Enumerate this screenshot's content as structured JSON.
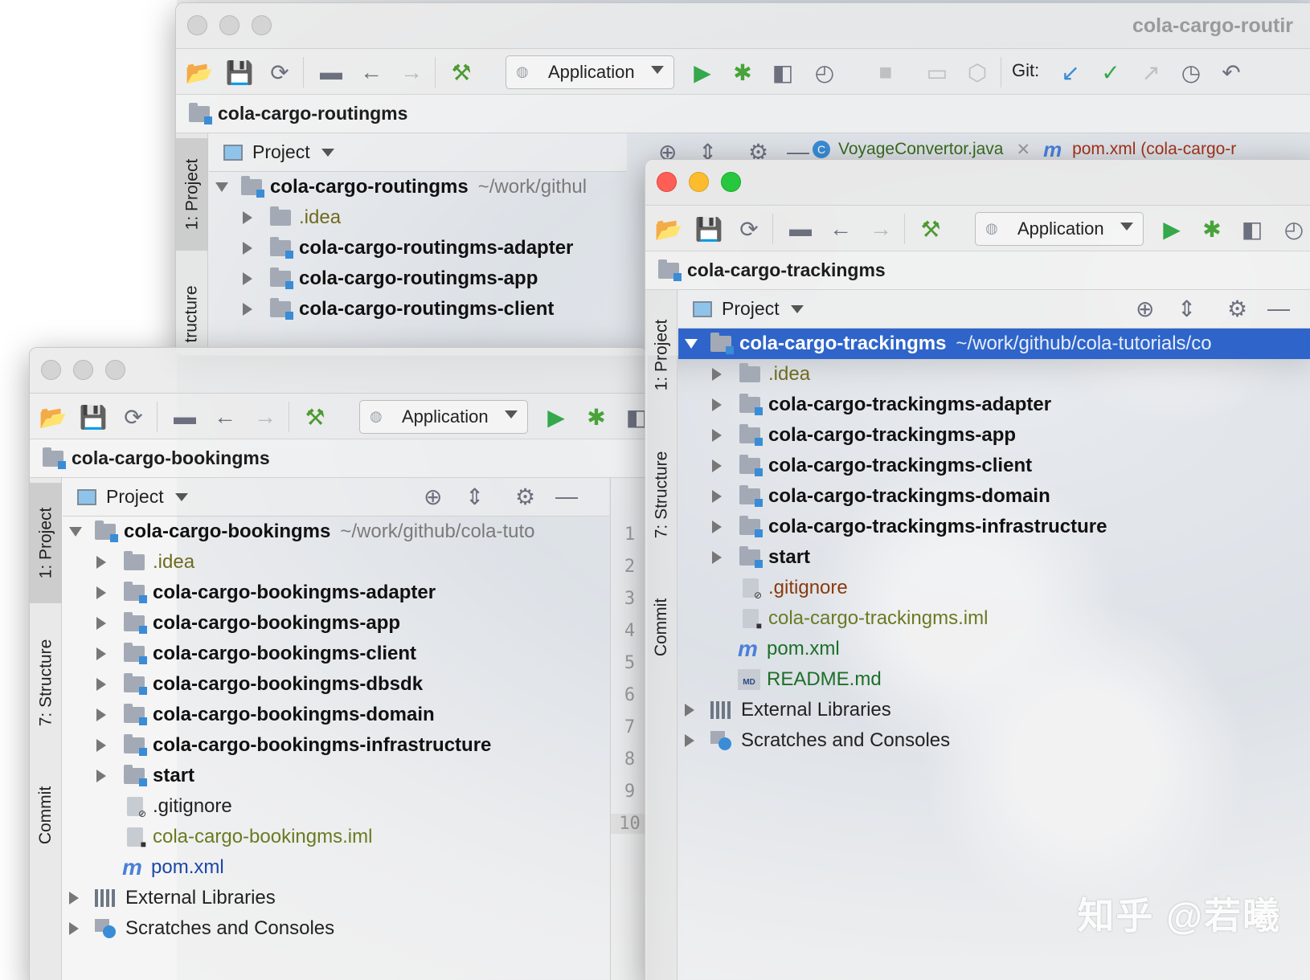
{
  "windows": {
    "routing": {
      "title": "cola-cargo-routir",
      "run_config": "Application",
      "git_label": "Git:",
      "breadcrumb": "cola-cargo-routingms",
      "panel_title": "Project",
      "side_tabs": [
        "1: Project",
        "tructure"
      ],
      "editor_tabs": [
        {
          "label": "VoyageConvertor.java",
          "icon": "C"
        },
        {
          "label": "pom.xml (cola-cargo-r",
          "icon": "m"
        }
      ],
      "tree": {
        "root_name": "cola-cargo-routingms",
        "root_path": "~/work/githul",
        "items": [
          ".idea",
          "cola-cargo-routingms-adapter",
          "cola-cargo-routingms-app",
          "cola-cargo-routingms-client"
        ]
      }
    },
    "booking": {
      "run_config": "Application",
      "breadcrumb": "cola-cargo-bookingms",
      "panel_title": "Project",
      "side_tabs": [
        "1: Project",
        "7: Structure",
        "Commit"
      ],
      "tree": {
        "root_name": "cola-cargo-bookingms",
        "root_path": "~/work/github/cola-tuto",
        "folders": [
          ".idea",
          "cola-cargo-bookingms-adapter",
          "cola-cargo-bookingms-app",
          "cola-cargo-bookingms-client",
          "cola-cargo-bookingms-dbsdk",
          "cola-cargo-bookingms-domain",
          "cola-cargo-bookingms-infrastructure",
          "start"
        ],
        "files": [
          ".gitignore",
          "cola-cargo-bookingms.iml",
          "pom.xml"
        ],
        "external": "External Libraries",
        "scratches": "Scratches and Consoles"
      },
      "gutter_lines": [
        "1",
        "2",
        "3",
        "4",
        "5",
        "6",
        "7",
        "8",
        "9",
        "10"
      ]
    },
    "tracking": {
      "run_config": "Application",
      "breadcrumb": "cola-cargo-trackingms",
      "panel_title": "Project",
      "side_tabs": [
        "1: Project",
        "7: Structure",
        "Commit"
      ],
      "tree": {
        "root_name": "cola-cargo-trackingms",
        "root_path": "~/work/github/cola-tutorials/co",
        "folders": [
          ".idea",
          "cola-cargo-trackingms-adapter",
          "cola-cargo-trackingms-app",
          "cola-cargo-trackingms-client",
          "cola-cargo-trackingms-domain",
          "cola-cargo-trackingms-infrastructure",
          "start"
        ],
        "files": [
          ".gitignore",
          "cola-cargo-trackingms.iml",
          "pom.xml",
          "README.md"
        ],
        "external": "External Libraries",
        "scratches": "Scratches and Consoles"
      }
    }
  },
  "watermark": "知乎 @若曦",
  "colors": {
    "selection": "#2f65ca",
    "run_green": "#34a84a",
    "git_blue": "#3a8cd6"
  },
  "icons": [
    "open-folder-icon",
    "save-icon",
    "sync-icon",
    "folder-icon",
    "back-arrow-icon",
    "forward-arrow-icon",
    "hammer-icon",
    "run-icon",
    "debug-icon",
    "coverage-icon",
    "profile-icon",
    "stop-icon",
    "git-update-icon",
    "git-commit-icon",
    "git-push-icon",
    "history-icon",
    "rollback-icon",
    "crosshair-icon",
    "collapse-icon",
    "gear-icon",
    "minimize-icon"
  ]
}
